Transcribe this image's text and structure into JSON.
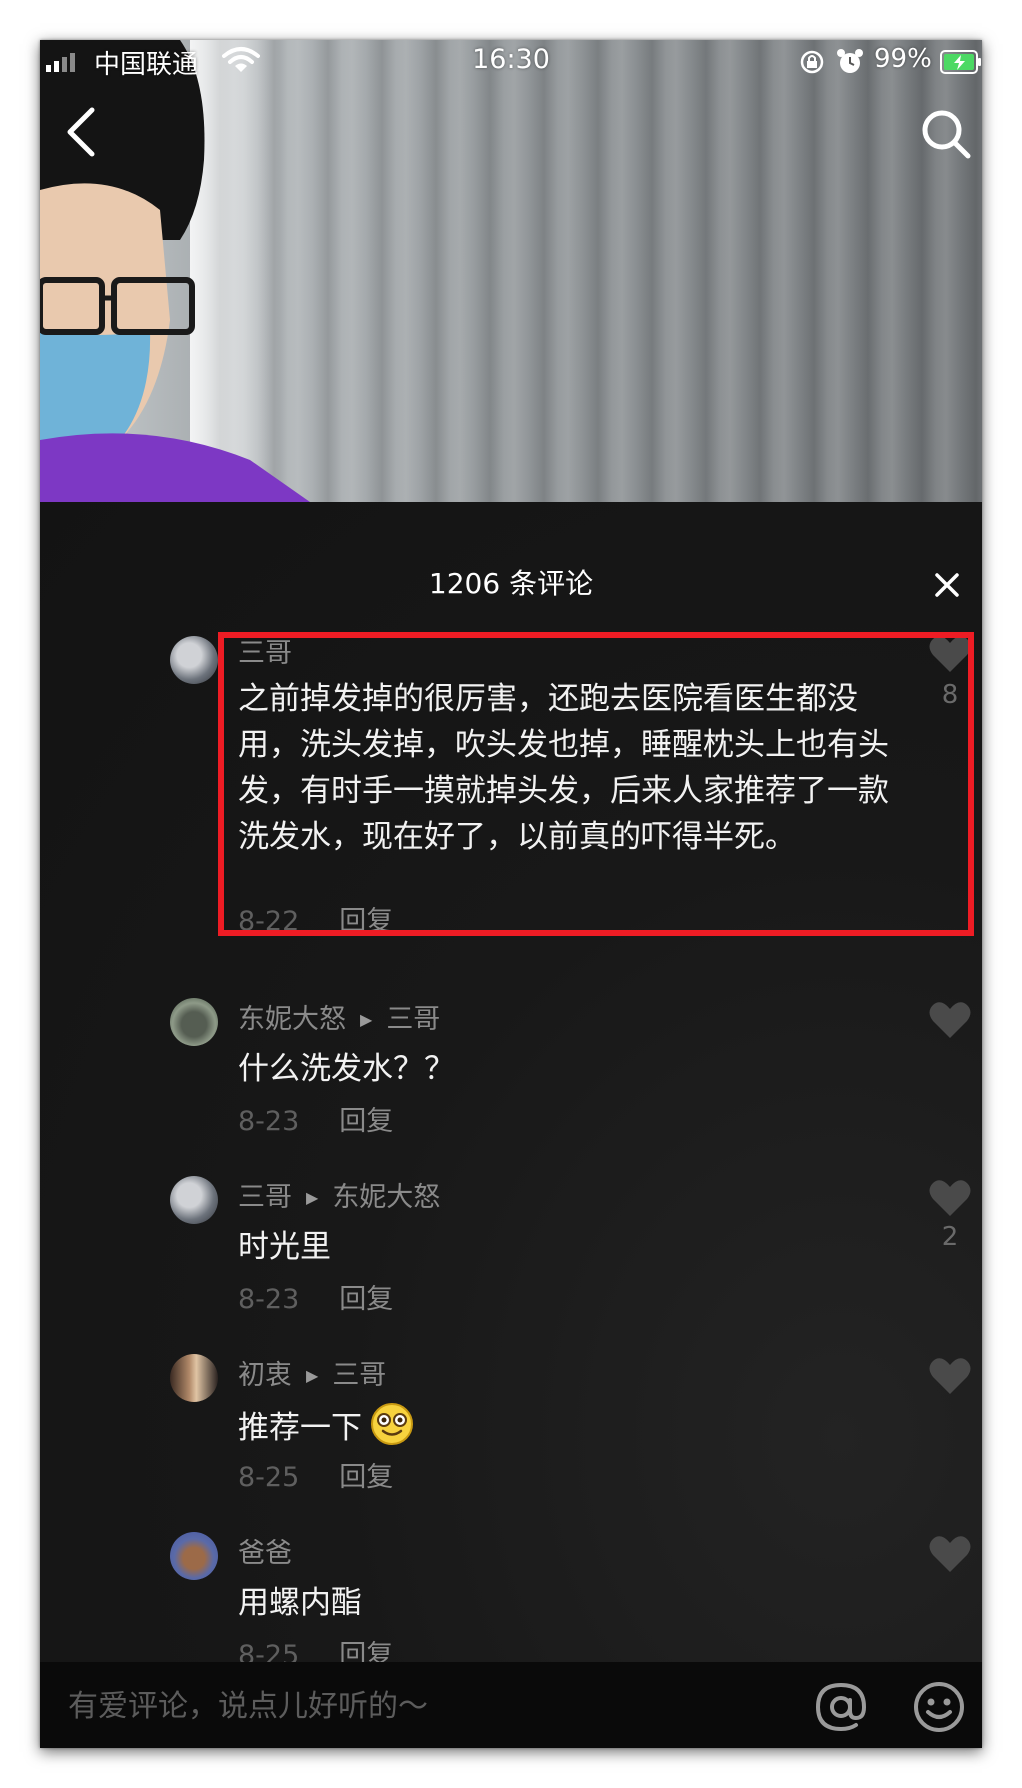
{
  "status_bar": {
    "carrier": "中国联通",
    "time": "16:30",
    "battery": "99%"
  },
  "comments_panel": {
    "title": "1206 条评论",
    "comments": [
      {
        "author": "三哥",
        "reply_to": "",
        "text": "之前掉发掉的很厉害，还跑去医院看医生都没用，洗头发掉，吹头发也掉，睡醒枕头上也有头发，有时手一摸就掉头发，后来人家推荐了一款洗发水，现在好了，以前真的吓得半死。",
        "date": "8-22",
        "reply_label": "回复",
        "likes": "8",
        "highlighted": true
      },
      {
        "author": "东妮大怒",
        "reply_to": "三哥",
        "text": "什么洗发水？？",
        "date": "8-23",
        "reply_label": "回复",
        "likes": ""
      },
      {
        "author": "三哥",
        "reply_to": "东妮大怒",
        "text": "时光里",
        "date": "8-23",
        "reply_label": "回复",
        "likes": "2"
      },
      {
        "author": "初衷",
        "reply_to": "三哥",
        "text": "推荐一下",
        "emoji": "smiling-face-emoji",
        "date": "8-25",
        "reply_label": "回复",
        "likes": ""
      },
      {
        "author": "爸爸",
        "reply_to": "",
        "text": "用螺内酯",
        "date": "8-25",
        "reply_label": "回复",
        "likes": ""
      }
    ]
  },
  "input_bar": {
    "placeholder": "有爱评论，说点儿好听的～"
  },
  "icons": {
    "back": "chevron-left-icon",
    "search": "search-icon",
    "close": "close-icon",
    "like": "heart-icon",
    "mention": "at-icon",
    "emoji": "emoji-icon"
  },
  "colors": {
    "panel_background": "#161616",
    "highlight_border": "#ee1c24",
    "battery_green": "#4cd964"
  }
}
